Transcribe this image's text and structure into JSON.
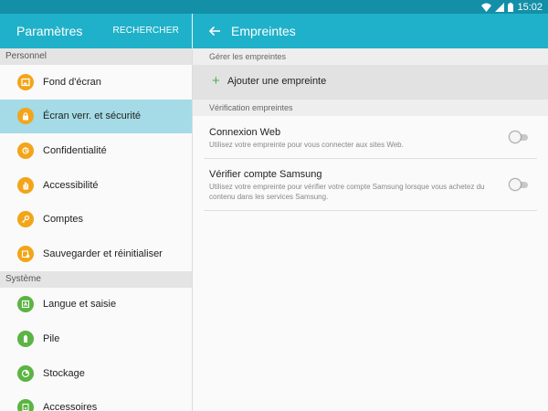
{
  "status_bar": {
    "time": "15:02"
  },
  "left_header": {
    "title": "Paramètres",
    "search_label": "RECHERCHER"
  },
  "right_header": {
    "title": "Empreintes"
  },
  "sidebar": {
    "sections": [
      {
        "label": "Personnel",
        "items": [
          {
            "label": "Fond d'écran",
            "icon": "wallpaper-icon",
            "color": "#f2a51a",
            "selected": false
          },
          {
            "label": "Écran verr. et sécurité",
            "icon": "lock-icon",
            "color": "#f2a51a",
            "selected": true
          },
          {
            "label": "Confidentialité",
            "icon": "privacy-icon",
            "color": "#f2a51a",
            "selected": false
          },
          {
            "label": "Accessibilité",
            "icon": "hand-icon",
            "color": "#f2a51a",
            "selected": false
          },
          {
            "label": "Comptes",
            "icon": "key-icon",
            "color": "#f2a51a",
            "selected": false
          },
          {
            "label": "Sauvegarder et réinitialiser",
            "icon": "backup-icon",
            "color": "#f2a51a",
            "selected": false
          }
        ]
      },
      {
        "label": "Système",
        "items": [
          {
            "label": "Langue et saisie",
            "icon": "language-icon",
            "color": "#5bb443",
            "selected": false
          },
          {
            "label": "Pile",
            "icon": "battery-icon",
            "color": "#5bb443",
            "selected": false
          },
          {
            "label": "Stockage",
            "icon": "storage-icon",
            "color": "#5bb443",
            "selected": false
          },
          {
            "label": "Accessoires",
            "icon": "accessories-icon",
            "color": "#5bb443",
            "selected": false
          }
        ]
      }
    ]
  },
  "main": {
    "manage_section": "Gérer les empreintes",
    "add_label": "Ajouter une empreinte",
    "verify_section": "Vérification empreintes",
    "settings": [
      {
        "title": "Connexion Web",
        "description": "Utilisez votre empreinte pour vous connecter aux sites Web.",
        "enabled": false
      },
      {
        "title": "Vérifier compte Samsung",
        "description": "Utilisez votre empreinte pour vérifier votre compte Samsung lorsque vous achetez du contenu dans les services Samsung.",
        "enabled": false
      }
    ]
  },
  "colors": {
    "header": "#1fb1c9",
    "status_bar": "#138fa7",
    "selected": "#a4dbe6",
    "accent_orange": "#f2a51a",
    "accent_green": "#5bb443"
  }
}
